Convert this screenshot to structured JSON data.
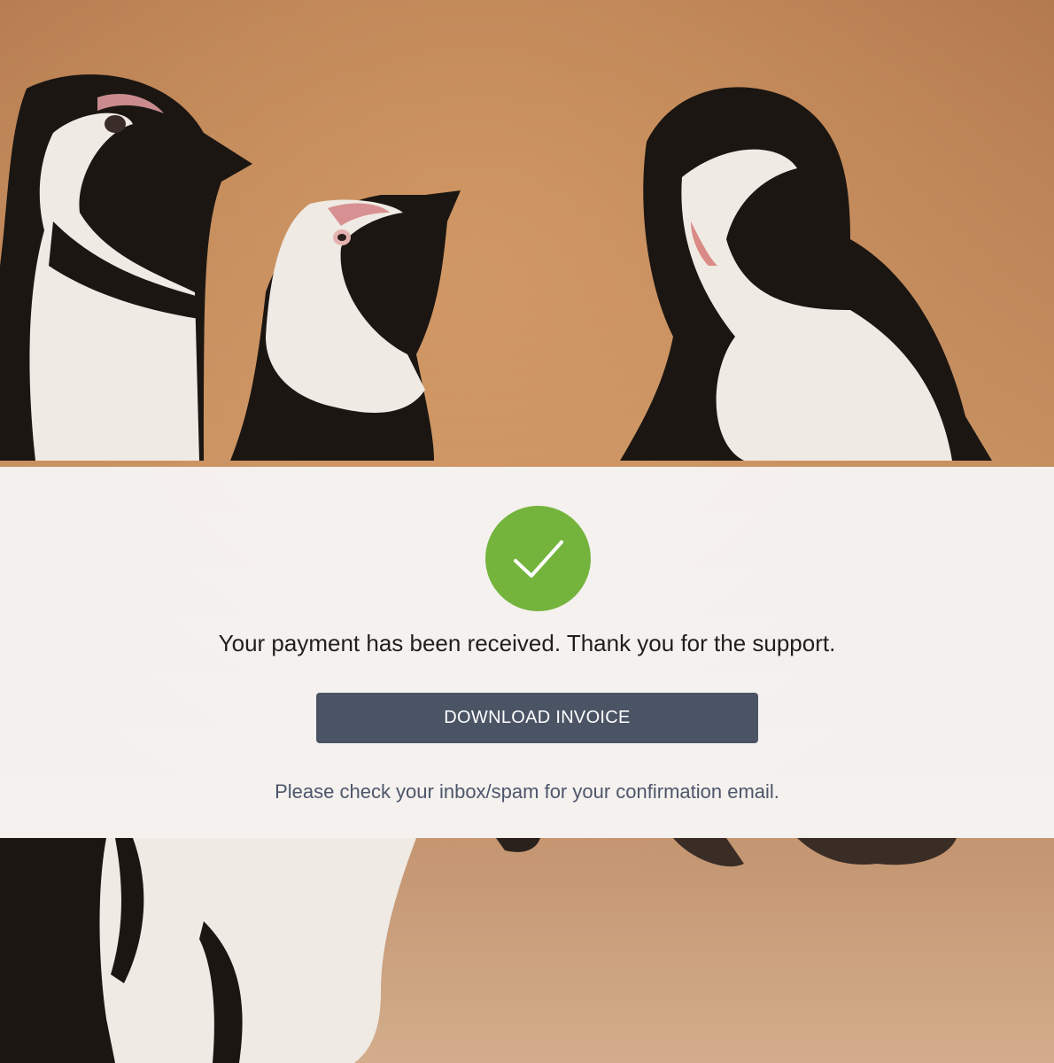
{
  "confirmation": {
    "message": "Your payment has been received. Thank you for the support.",
    "status_icon": "checkmark-icon",
    "status_color": "#74b43d"
  },
  "actions": {
    "download_invoice_label": "DOWNLOAD INVOICE",
    "button_color": "#4b5465"
  },
  "notice": {
    "text": "Please check your inbox/spam for your confirmation email."
  },
  "background": {
    "image": "penguins-on-beach-photo"
  }
}
